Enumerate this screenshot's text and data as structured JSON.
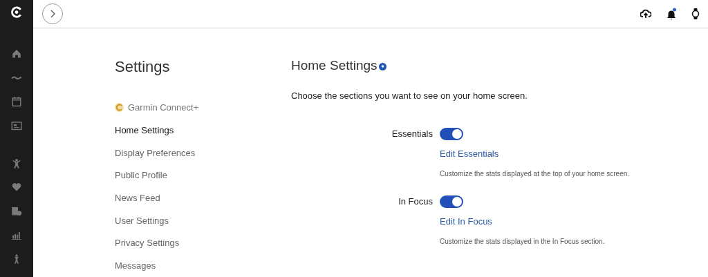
{
  "sidebar": {
    "title": "Settings",
    "items": [
      {
        "label": "Garmin Connect+",
        "kind": "premium",
        "selected": false
      },
      {
        "label": "Home Settings",
        "kind": "plain",
        "selected": true
      },
      {
        "label": "Display Preferences",
        "kind": "plain",
        "selected": false
      },
      {
        "label": "Public Profile",
        "kind": "plain",
        "selected": false
      },
      {
        "label": "News Feed",
        "kind": "plain",
        "selected": false
      },
      {
        "label": "User Settings",
        "kind": "plain",
        "selected": false
      },
      {
        "label": "Privacy Settings",
        "kind": "plain",
        "selected": false
      },
      {
        "label": "Messages",
        "kind": "plain",
        "selected": false
      }
    ]
  },
  "main": {
    "title": "Home Settings",
    "intro": "Choose the sections you want to see on your home screen.",
    "sections": [
      {
        "label": "Essentials",
        "on": true,
        "link": "Edit Essentials",
        "description": "Customize the stats displayed at the top of your home screen."
      },
      {
        "label": "In Focus",
        "on": true,
        "link": "Edit In Focus",
        "description": "Customize the stats displayed in the In Focus section."
      }
    ]
  }
}
